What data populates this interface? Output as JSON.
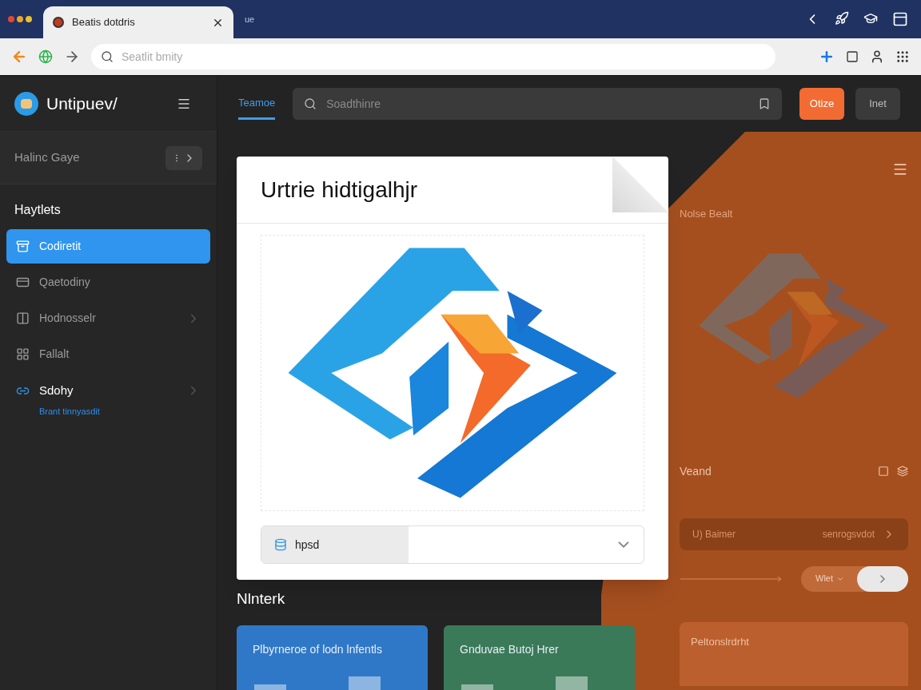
{
  "browser": {
    "tab_title": "Beatis dotdris",
    "tab_extra": "ue",
    "address_placeholder": "Seatlit bmity"
  },
  "sidebar": {
    "app_name": "Untipuev/",
    "section": {
      "label": "Halinc Gaye"
    },
    "heading": "Haytlets",
    "items": [
      {
        "label": "Codiretit",
        "selected": true,
        "expandable": false
      },
      {
        "label": "Qaetodiny",
        "selected": false,
        "expandable": false
      },
      {
        "label": "Hodnosselr",
        "selected": false,
        "expandable": true
      },
      {
        "label": "Fallalt",
        "selected": false,
        "expandable": false
      },
      {
        "label": "Sdohy",
        "selected": false,
        "expandable": true,
        "subtitle": "Brant tinnyasdit"
      }
    ]
  },
  "toolbar": {
    "tabs": [
      {
        "label": "Teamoe",
        "selected": true
      }
    ],
    "search": {
      "placeholder": "Soadthinre"
    },
    "buttons": [
      {
        "label": "Otize",
        "kind": "primary"
      },
      {
        "label": "Inet",
        "kind": "secondary"
      }
    ]
  },
  "card": {
    "title": "Urtrie hidtigalhjr",
    "field": {
      "label": "hpsd"
    }
  },
  "section_heading": "Nlnterk",
  "tiles": [
    {
      "title": "Plbyrneroe of lodn lnfentls",
      "color": "#2f78c8"
    },
    {
      "title": "Gnduvae Butoj Hrer",
      "color": "#3a7a58"
    }
  ],
  "side_panel": {
    "title": "Nolse Bealt",
    "subtitle": "Veand",
    "row": {
      "label": "U) Baimer",
      "value": "senrogsvdot"
    },
    "pager": {
      "label": "Wlet"
    },
    "tile": {
      "title": "Peltonslrdrht"
    }
  }
}
